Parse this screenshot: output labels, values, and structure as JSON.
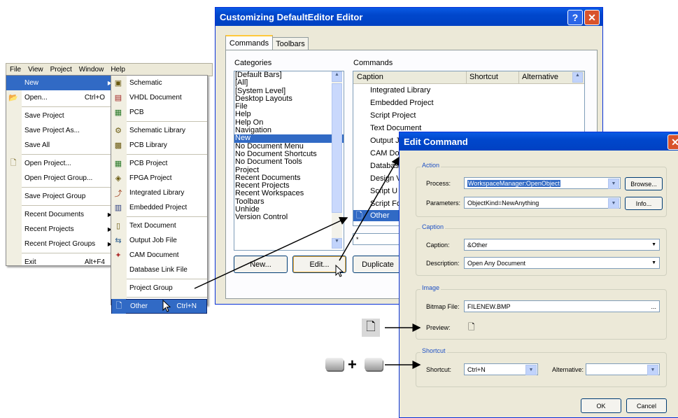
{
  "menubar": {
    "items": [
      "File",
      "View",
      "Project",
      "Window",
      "Help"
    ]
  },
  "file_menu": {
    "items": [
      {
        "label": "New",
        "shortcut": "",
        "submenu": true,
        "highlighted": true
      },
      {
        "label": "Open...",
        "shortcut": "Ctrl+O",
        "icon": "open-folder-icon"
      },
      {
        "label": "Save Project",
        "shortcut": ""
      },
      {
        "label": "Save Project As...",
        "shortcut": ""
      },
      {
        "label": "Save All",
        "shortcut": ""
      },
      {
        "label": "Open Project...",
        "shortcut": "",
        "icon": "open-project-icon"
      },
      {
        "label": "Open Project Group...",
        "shortcut": ""
      },
      {
        "label": "Save Project Group",
        "shortcut": ""
      },
      {
        "label": "Recent Documents",
        "submenu": true
      },
      {
        "label": "Recent Projects",
        "submenu": true
      },
      {
        "label": "Recent Project Groups",
        "submenu": true
      },
      {
        "label": "Exit",
        "shortcut": "Alt+F4"
      }
    ]
  },
  "new_menu": {
    "items": [
      {
        "label": "Schematic",
        "icon": "schematic-icon"
      },
      {
        "label": "VHDL Document",
        "icon": "vhdl-icon"
      },
      {
        "label": "PCB",
        "icon": "pcb-icon"
      },
      {
        "label": "Schematic Library",
        "icon": "schematic-library-icon"
      },
      {
        "label": "PCB Library",
        "icon": "pcb-library-icon"
      },
      {
        "label": "PCB Project",
        "icon": "pcb-project-icon"
      },
      {
        "label": "FPGA Project",
        "icon": "fpga-project-icon"
      },
      {
        "label": "Integrated Library",
        "icon": "integrated-library-icon"
      },
      {
        "label": "Embedded Project",
        "icon": "embedded-project-icon"
      },
      {
        "label": "Text Document",
        "icon": "text-document-icon"
      },
      {
        "label": "Output Job File",
        "icon": "output-job-icon"
      },
      {
        "label": "CAM Document",
        "icon": "cam-document-icon"
      },
      {
        "label": "Database Link File"
      },
      {
        "label": "Project Group"
      },
      {
        "label": "Other",
        "shortcut": "Ctrl+N",
        "icon": "document-icon",
        "highlighted": true
      }
    ]
  },
  "customize": {
    "title": "Customizing DefaultEditor Editor",
    "tabs": [
      "Commands",
      "Toolbars"
    ],
    "categories_label": "Categories",
    "commands_label": "Commands",
    "categories": [
      "[Default Bars]",
      "[All]",
      "[System Level]",
      "Desktop Layouts",
      "File",
      "Help",
      "Help On",
      "Navigation",
      "New",
      "No Document Menu",
      "No Document Shortcuts",
      "No Document Tools",
      "Project",
      "Recent Documents",
      "Recent Projects",
      "Recent Workspaces",
      "Toolbars",
      "Unhide",
      "Version Control"
    ],
    "selected_category": "New",
    "columns": [
      "Caption",
      "Shortcut",
      "Alternative"
    ],
    "commands": [
      "Integrated Library",
      "Embedded Project",
      "Script Project",
      "Text Document",
      "Output J",
      "CAM Do",
      "Databas",
      "Design V",
      "Script U",
      "Script Fo",
      "Other"
    ],
    "search_value": "*",
    "buttons": {
      "new": "New...",
      "edit": "Edit...",
      "duplicate": "Duplicate"
    }
  },
  "edit_command": {
    "title": "Edit Command",
    "action_group": "Action",
    "process_label": "Process:",
    "process_value": "WorkspaceManager:OpenObject",
    "browse_label": "Browse...",
    "parameters_label": "Parameters:",
    "parameters_value": "ObjectKind=NewAnything",
    "info_label": "Info...",
    "caption_group": "Caption",
    "caption_label": "Caption:",
    "caption_value": "&Other",
    "description_label": "Description:",
    "description_value": "Open Any Document",
    "image_group": "Image",
    "bitmap_label": "Bitmap File:",
    "bitmap_value": "FILENEW.BMP",
    "bitmap_browse": "...",
    "preview_label": "Preview:",
    "shortcut_group": "Shortcut",
    "shortcut_label": "Shortcut:",
    "shortcut_value": "Ctrl+N",
    "alternative_label": "Alternative:",
    "alternative_value": "",
    "ok_label": "OK",
    "cancel_label": "Cancel"
  },
  "callout": {
    "plus": "+"
  }
}
